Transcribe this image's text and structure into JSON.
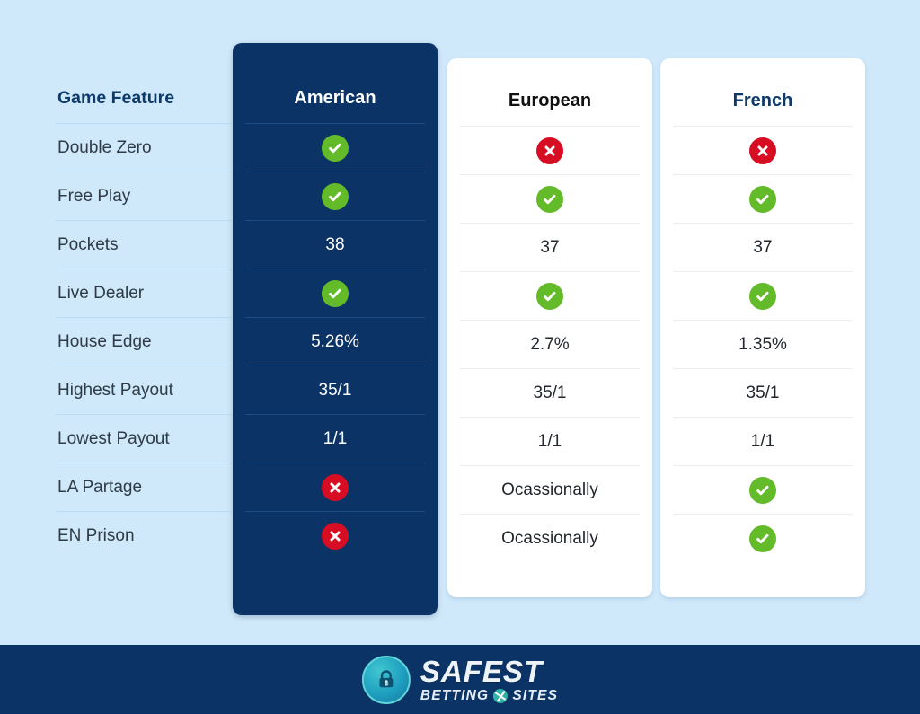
{
  "colors": {
    "page_background": "#cfe8fa",
    "highlight_card": "#0b3366",
    "footer_bar": "#0b3366",
    "yes_green": "#63bb29",
    "no_red": "#d60d23",
    "heading_navy": "#0d3a6b",
    "logo_teal": "#2fb3a6"
  },
  "table": {
    "feature_column": {
      "header": "Game Feature",
      "rows": [
        "Double Zero",
        "Free Play",
        "Pockets",
        "Live Dealer",
        "House Edge",
        "Highest Payout",
        "Lowest Payout",
        "LA Partage",
        "EN Prison"
      ]
    },
    "columns": [
      {
        "key": "american",
        "header": "American",
        "highlighted": true,
        "values": [
          {
            "type": "icon",
            "icon": "check-circle-icon",
            "text": ""
          },
          {
            "type": "icon",
            "icon": "check-circle-icon",
            "text": ""
          },
          {
            "type": "text",
            "icon": "",
            "text": "38"
          },
          {
            "type": "icon",
            "icon": "check-circle-icon",
            "text": ""
          },
          {
            "type": "text",
            "icon": "",
            "text": "5.26%"
          },
          {
            "type": "text",
            "icon": "",
            "text": "35/1"
          },
          {
            "type": "text",
            "icon": "",
            "text": "1/1"
          },
          {
            "type": "icon",
            "icon": "cross-circle-icon",
            "text": ""
          },
          {
            "type": "icon",
            "icon": "cross-circle-icon",
            "text": ""
          }
        ]
      },
      {
        "key": "european",
        "header": "European",
        "highlighted": false,
        "values": [
          {
            "type": "icon",
            "icon": "cross-circle-icon",
            "text": ""
          },
          {
            "type": "icon",
            "icon": "check-circle-icon",
            "text": ""
          },
          {
            "type": "text",
            "icon": "",
            "text": "37"
          },
          {
            "type": "icon",
            "icon": "check-circle-icon",
            "text": ""
          },
          {
            "type": "text",
            "icon": "",
            "text": "2.7%"
          },
          {
            "type": "text",
            "icon": "",
            "text": "35/1"
          },
          {
            "type": "text",
            "icon": "",
            "text": "1/1"
          },
          {
            "type": "text",
            "icon": "",
            "text": "Ocassionally"
          },
          {
            "type": "text",
            "icon": "",
            "text": "Ocassionally"
          }
        ]
      },
      {
        "key": "french",
        "header": "French",
        "highlighted": false,
        "values": [
          {
            "type": "icon",
            "icon": "cross-circle-icon",
            "text": ""
          },
          {
            "type": "icon",
            "icon": "check-circle-icon",
            "text": ""
          },
          {
            "type": "text",
            "icon": "",
            "text": "37"
          },
          {
            "type": "icon",
            "icon": "check-circle-icon",
            "text": ""
          },
          {
            "type": "text",
            "icon": "",
            "text": "1.35%"
          },
          {
            "type": "text",
            "icon": "",
            "text": "35/1"
          },
          {
            "type": "text",
            "icon": "",
            "text": "1/1"
          },
          {
            "type": "icon",
            "icon": "check-circle-icon",
            "text": ""
          },
          {
            "type": "icon",
            "icon": "check-circle-icon",
            "text": ""
          }
        ]
      }
    ]
  },
  "footer": {
    "logo": {
      "badge_icon": "padlock-badge-icon",
      "line1": "SAFEST",
      "line2_left": "BETTING",
      "line2_right": "SITES",
      "wheel_icon": "roulette-wheel-icon"
    }
  }
}
